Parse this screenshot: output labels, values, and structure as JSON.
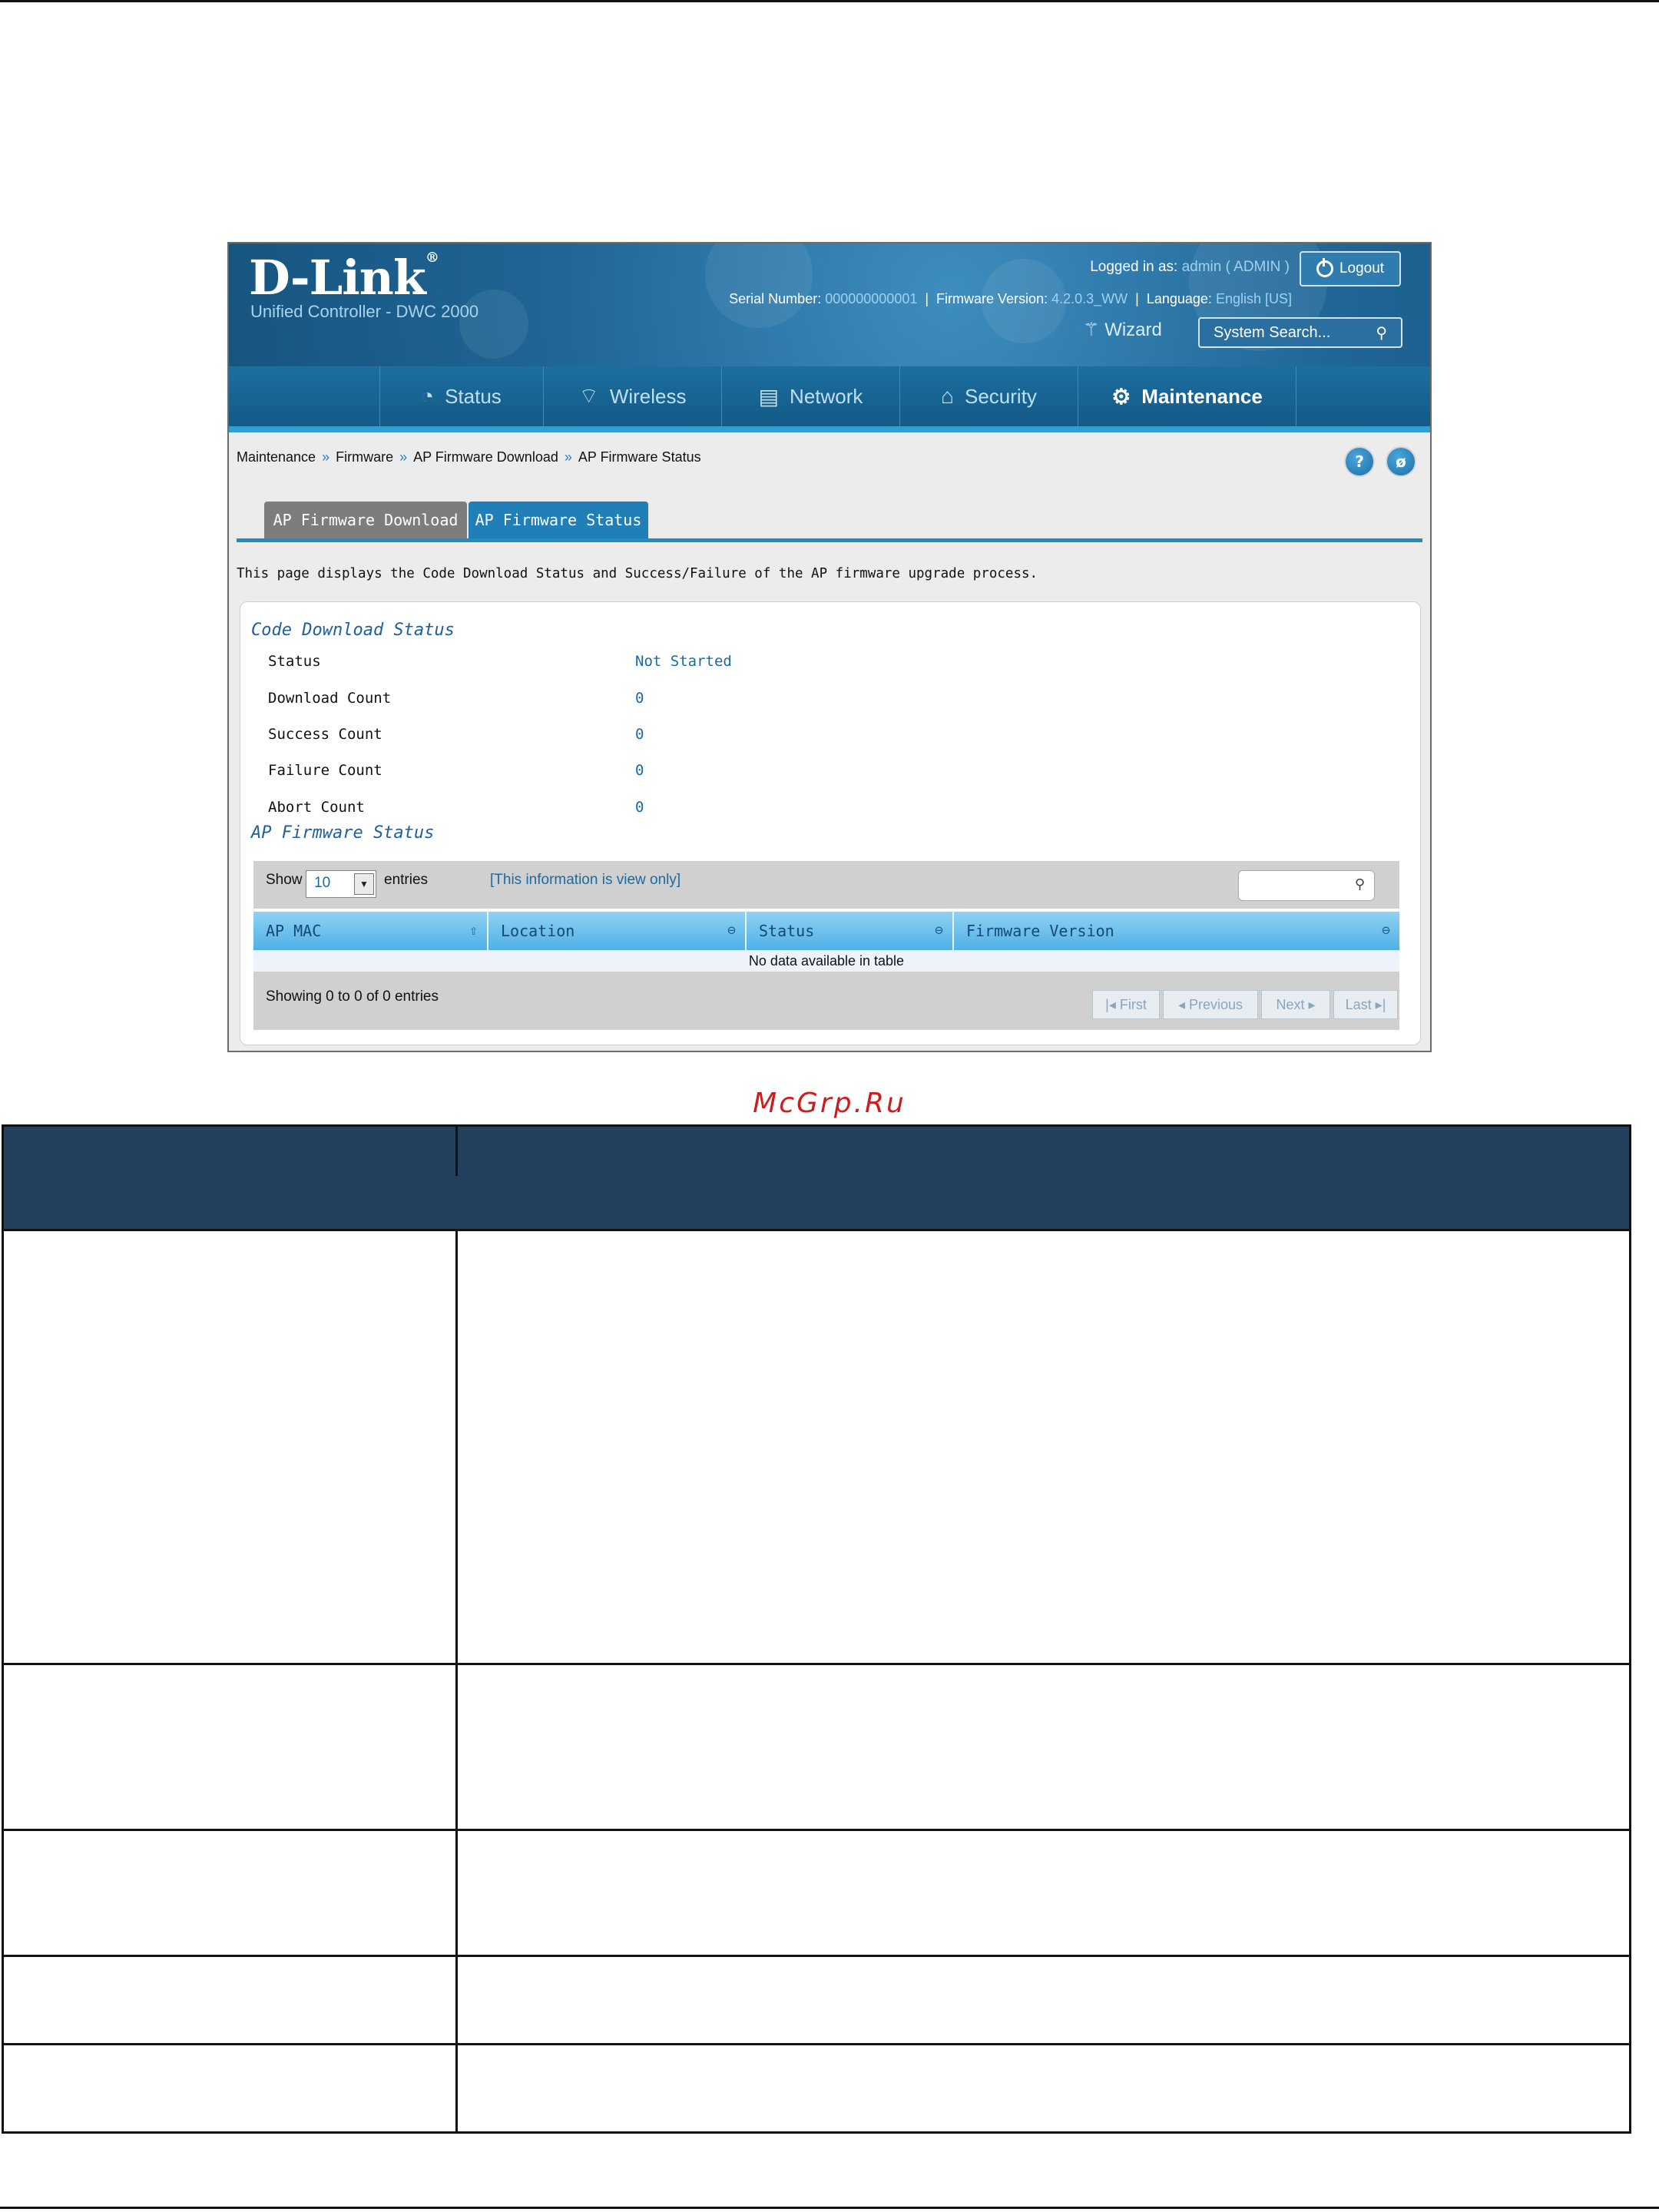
{
  "brand": {
    "logo": "D-Link",
    "reg": "®",
    "subtitle": "Unified Controller - DWC 2000"
  },
  "header": {
    "logged_label": "Logged in as:",
    "logged_value": "admin ( ADMIN )",
    "serial_label": "Serial Number:",
    "serial_value": "000000000001",
    "firmware_label": "Firmware Version:",
    "firmware_value": "4.2.0.3_WW",
    "language_label": "Language:",
    "language_value": "English [US]",
    "logout": "Logout",
    "wizard": "Wizard",
    "search_placeholder": "System Search..."
  },
  "nav": {
    "items": [
      {
        "label": "Status",
        "icon": "dashboard-icon"
      },
      {
        "label": "Wireless",
        "icon": "wifi-icon"
      },
      {
        "label": "Network",
        "icon": "monitor-icon"
      },
      {
        "label": "Security",
        "icon": "lock-icon"
      },
      {
        "label": "Maintenance",
        "icon": "gears-icon"
      }
    ]
  },
  "breadcrumb": {
    "items": [
      "Maintenance",
      "Firmware",
      "AP Firmware Download",
      "AP Firmware Status"
    ],
    "sep": "»"
  },
  "tabs": [
    {
      "label": "AP Firmware Download"
    },
    {
      "label": "AP Firmware Status"
    }
  ],
  "page_desc": "This page displays the Code Download Status and Success/Failure of the AP firmware upgrade process.",
  "code_download": {
    "title": "Code Download Status",
    "rows": [
      {
        "label": "Status",
        "value": "Not Started"
      },
      {
        "label": "Download Count",
        "value": "0"
      },
      {
        "label": "Success Count",
        "value": "0"
      },
      {
        "label": "Failure Count",
        "value": "0"
      },
      {
        "label": "Abort Count",
        "value": "0"
      }
    ]
  },
  "ap_status": {
    "title": "AP Firmware Status",
    "show": "Show",
    "entries_value": "10",
    "entries": "entries",
    "view_only": "[This information is view only]",
    "columns": [
      "AP MAC",
      "Location",
      "Status",
      "Firmware Version"
    ],
    "no_data": "No data available in table",
    "showing": "Showing 0 to 0 of 0 entries",
    "pager": [
      "First",
      "Previous",
      "Next",
      "Last"
    ]
  },
  "watermark": "McGrp.Ru",
  "colors": {
    "header_blue": "#1f6596",
    "nav_accent": "#2d9fd6",
    "table_header": "#24405f"
  }
}
